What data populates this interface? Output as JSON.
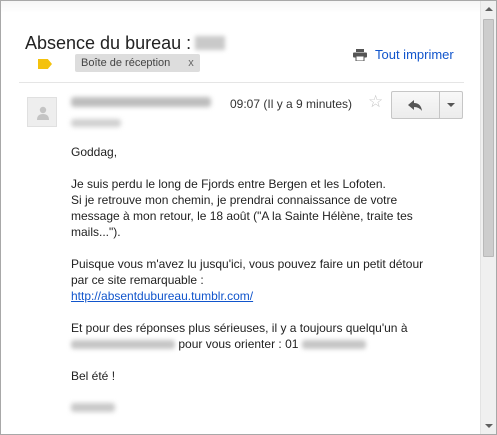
{
  "header": {
    "subject": "Absence du bureau :",
    "label_chip": "Boîte de réception",
    "label_remove": "x",
    "print_all": "Tout imprimer"
  },
  "message": {
    "time": "09:07 (Il y a 9 minutes)",
    "star_glyph": "☆",
    "body": {
      "greeting": "Goddag,",
      "p1_line1": "Je suis perdu le long de Fjords entre Bergen et les Lofoten.",
      "p1_line2": "Si je retrouve mon chemin, je prendrai connaissance de votre",
      "p1_line3": "message à mon retour, le 18 août (\"A la Sainte Hélène, traite tes",
      "p1_line4": "mails...\").",
      "p2_line1": "Puisque vous m'avez lu jusqu'ici, vous pouvez faire un petit détour",
      "p2_line2": "par ce site remarquable :",
      "link": "http://absentdubureau.tumblr.com/",
      "p3_line1": "Et pour des réponses plus sérieuses, il y a toujours quelqu'un à",
      "p3_line2_suffix": "pour vous orienter : 01",
      "closing": "Bel été !"
    }
  },
  "colors": {
    "link": "#1155cc",
    "label_tag": "#f4c20d"
  },
  "icons": [
    "label-tag-icon",
    "printer-icon",
    "avatar-icon",
    "star-icon",
    "reply-icon",
    "caret-down-icon"
  ]
}
